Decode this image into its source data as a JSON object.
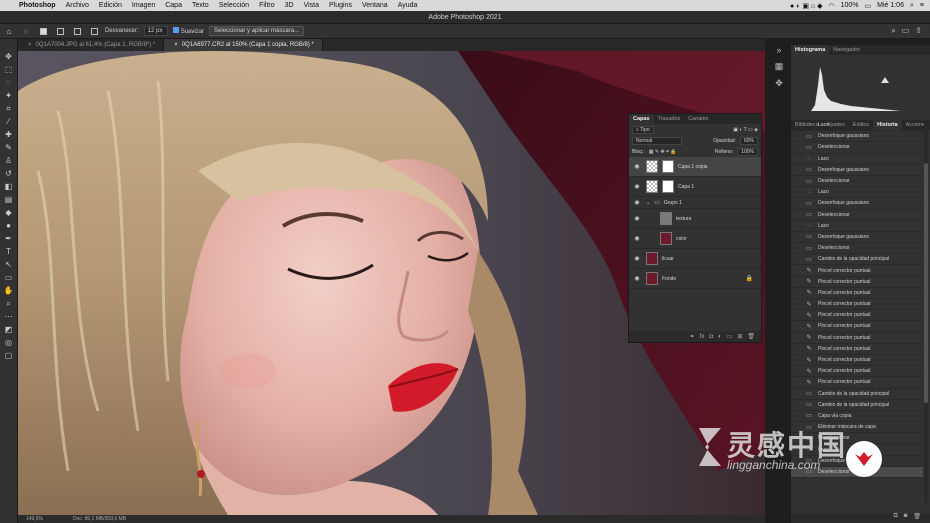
{
  "menubar": {
    "items": [
      "Photoshop",
      "Archivo",
      "Edición",
      "Imagen",
      "Capa",
      "Texto",
      "Selección",
      "Filtro",
      "3D",
      "Vista",
      "Plugins",
      "Ventana",
      "Ayuda"
    ],
    "battery": "100%",
    "clock": "Mié 1:06"
  },
  "window": {
    "title": "Adobe Photoshop 2021"
  },
  "options": {
    "feather_label": "Desvanecer:",
    "feather_value": "12 px",
    "antialias_label": "Suavizar",
    "mask_button": "Seleccionar y aplicar máscara..."
  },
  "tabs": [
    {
      "label": "0Q1A7004.JPG al 61,4% (Capa 1, RGB/8*) *"
    },
    {
      "label": "0Q1A6977.CR2 al 150% (Capa 1 copia, RGB/8) *"
    }
  ],
  "status": {
    "zoom": "149,6%",
    "doc": "Doc: 86,1 MB/359,6 MB"
  },
  "panel_tabs_top": [
    "Histograma",
    "Navegador"
  ],
  "panel_tabs_bottom": [
    "Biblioteca",
    "Ajustes",
    "Estilos",
    "Historia",
    "Acciones"
  ],
  "history": [
    {
      "icon": "lasso-icon",
      "label": "Lazo"
    },
    {
      "icon": "filter-icon",
      "label": "Desenfoque gaussiano"
    },
    {
      "icon": "doc-icon",
      "label": "Deseleccionar"
    },
    {
      "icon": "lasso-icon",
      "label": "Lazo"
    },
    {
      "icon": "filter-icon",
      "label": "Desenfoque gaussiano"
    },
    {
      "icon": "doc-icon",
      "label": "Deseleccionar"
    },
    {
      "icon": "lasso-icon",
      "label": "Lazo"
    },
    {
      "icon": "filter-icon",
      "label": "Desenfoque gaussiano"
    },
    {
      "icon": "doc-icon",
      "label": "Deseleccionar"
    },
    {
      "icon": "lasso-icon",
      "label": "Lazo"
    },
    {
      "icon": "filter-icon",
      "label": "Desenfoque gaussiano"
    },
    {
      "icon": "doc-icon",
      "label": "Deseleccionar"
    },
    {
      "icon": "doc-icon",
      "label": "Cambio de la opacidad principal"
    },
    {
      "icon": "brush-icon",
      "label": "Pincel corrector puntual"
    },
    {
      "icon": "brush-icon",
      "label": "Pincel corrector puntual"
    },
    {
      "icon": "brush-icon",
      "label": "Pincel corrector puntual"
    },
    {
      "icon": "brush-icon",
      "label": "Pincel corrector puntual"
    },
    {
      "icon": "brush-icon",
      "label": "Pincel corrector puntual"
    },
    {
      "icon": "brush-icon",
      "label": "Pincel corrector puntual"
    },
    {
      "icon": "brush-icon",
      "label": "Pincel corrector puntual"
    },
    {
      "icon": "brush-icon",
      "label": "Pincel corrector puntual"
    },
    {
      "icon": "brush-icon",
      "label": "Pincel corrector puntual"
    },
    {
      "icon": "brush-icon",
      "label": "Pincel corrector puntual"
    },
    {
      "icon": "brush-icon",
      "label": "Pincel corrector puntual"
    },
    {
      "icon": "doc-icon",
      "label": "Cambio de la opacidad principal"
    },
    {
      "icon": "doc-icon",
      "label": "Cambio de la opacidad principal"
    },
    {
      "icon": "doc-icon",
      "label": "Capa vía copia"
    },
    {
      "icon": "doc-icon",
      "label": "Eliminar máscara de capa"
    },
    {
      "icon": "doc-icon",
      "label": "Deseleccionar"
    },
    {
      "icon": "lasso-icon",
      "label": "Lazo"
    },
    {
      "icon": "filter-icon",
      "label": "Desenfoque gaussiano"
    },
    {
      "icon": "doc-icon",
      "label": "Deseleccionar"
    }
  ],
  "layers_panel": {
    "tabs": [
      "Capas",
      "Trazados",
      "Canales"
    ],
    "filter": "Tipo",
    "blend": "Normal",
    "opacity_label": "Opacidad:",
    "opacity_value": "60%",
    "lock_label": "Bloq.:",
    "fill_label": "Relleno:",
    "fill_value": "100%",
    "layers": [
      {
        "name": "Capa 1 copia",
        "thumb": "checker",
        "mask": true,
        "selected": true
      },
      {
        "name": "Capa 1",
        "thumb": "checker",
        "mask": true,
        "selected": false
      },
      {
        "name": "Grupo 1",
        "thumb": "folder",
        "mask": false,
        "selected": false
      },
      {
        "name": "textura",
        "thumb": "gray",
        "mask": false,
        "selected": false
      },
      {
        "name": "color",
        "thumb": "dark",
        "mask": false,
        "selected": false
      },
      {
        "name": "licuar",
        "thumb": "dark",
        "mask": false,
        "selected": false
      },
      {
        "name": "Fondo",
        "thumb": "dark",
        "mask": false,
        "selected": false,
        "locked": true
      }
    ]
  },
  "watermark": {
    "chinese": "灵感中国",
    "url": "lingganchina.com"
  }
}
